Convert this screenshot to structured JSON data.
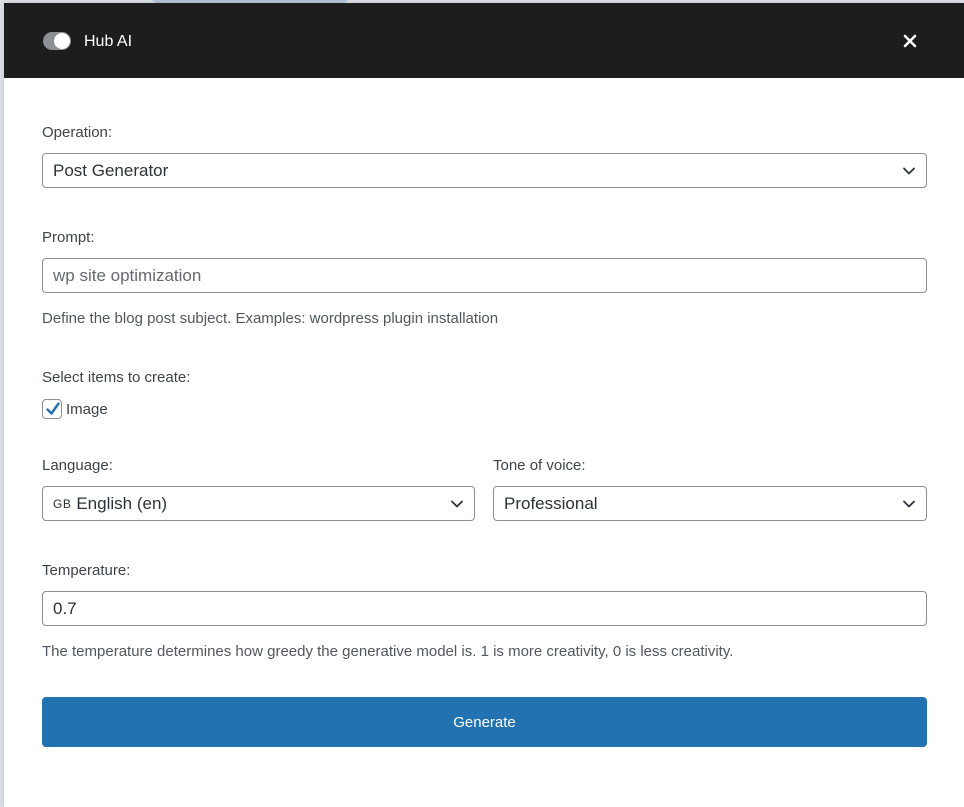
{
  "header": {
    "title": "Hub AI",
    "toggle_on": true
  },
  "form": {
    "operation": {
      "label": "Operation:",
      "selected": "Post Generator"
    },
    "prompt": {
      "label": "Prompt:",
      "placeholder": "wp site optimization",
      "value": "",
      "help": "Define the blog post subject. Examples: wordpress plugin installation"
    },
    "items": {
      "label": "Select items to create:",
      "image_label": "Image",
      "image_checked": true
    },
    "language": {
      "label": "Language:",
      "flag": "GB",
      "selected": "English (en)"
    },
    "tone": {
      "label": "Tone of voice:",
      "selected": "Professional"
    },
    "temperature": {
      "label": "Temperature:",
      "value": "0.7",
      "help": "The temperature determines how greedy the generative model is. 1 is more creativity, 0 is less creativity."
    },
    "generate_label": "Generate"
  },
  "colors": {
    "header_bg": "#1d1d1d",
    "primary": "#2271b1",
    "checkbox_accent": "#2271b1"
  }
}
